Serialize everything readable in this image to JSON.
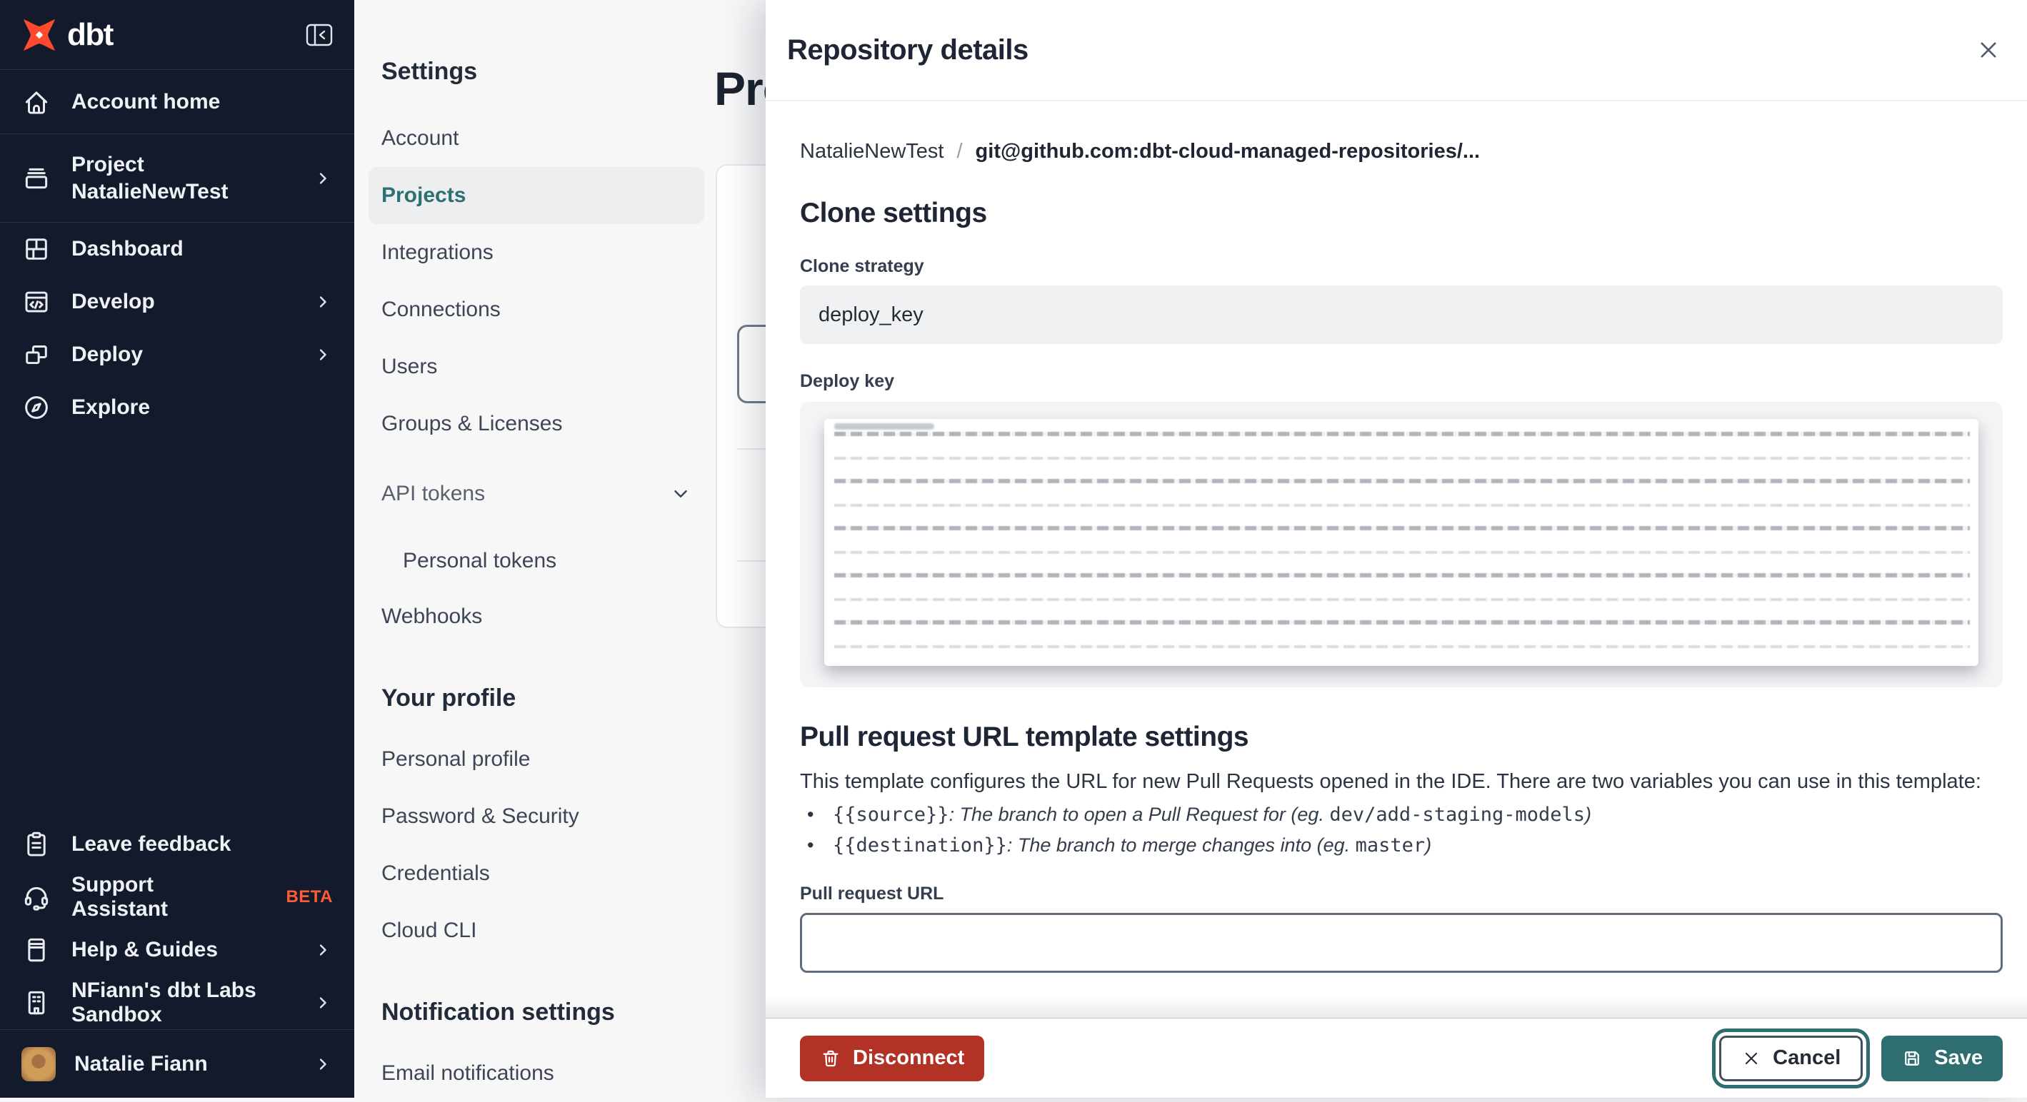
{
  "colors": {
    "brand_orange": "#ff4a2e",
    "accent_teal": "#2f6e70",
    "danger_red": "#b23226",
    "sidebar_bg": "#131a2b",
    "beta_orange": "#ff5c35"
  },
  "sidebar": {
    "logo_text": "dbt",
    "nav": [
      {
        "label": "Account home",
        "icon": "home"
      },
      {
        "label": "Project",
        "label2": "NatalieNewTest",
        "icon": "project"
      },
      {
        "label": "Dashboard",
        "icon": "dashboard"
      },
      {
        "label": "Develop",
        "icon": "develop"
      },
      {
        "label": "Deploy",
        "icon": "deploy"
      },
      {
        "label": "Explore",
        "icon": "explore"
      }
    ],
    "footer": [
      {
        "label": "Leave feedback",
        "icon": "clipboard"
      },
      {
        "label": "Support Assistant",
        "badge": "BETA",
        "icon": "headset"
      },
      {
        "label": "Help & Guides",
        "icon": "book"
      },
      {
        "label": "NFiann's dbt Labs Sandbox",
        "icon": "building"
      }
    ],
    "user": {
      "name": "Natalie Fiann"
    }
  },
  "settings_nav": {
    "title": "Settings",
    "items": {
      "account": "Account",
      "projects": "Projects",
      "integrations": "Integrations",
      "connections": "Connections",
      "users": "Users",
      "groups": "Groups & Licenses",
      "api_tokens": "API tokens",
      "personal_tokens": "Personal tokens",
      "webhooks": "Webhooks"
    },
    "profile_section": {
      "title": "Your profile",
      "personal_profile": "Personal profile",
      "password_security": "Password & Security",
      "credentials": "Credentials",
      "cloud_cli": "Cloud CLI"
    },
    "notification_section": {
      "title": "Notification settings",
      "email_notifications": "Email notifications"
    }
  },
  "main": {
    "heading": "Projects"
  },
  "drawer": {
    "title": "Repository details",
    "breadcrumb": {
      "project": "NatalieNewTest",
      "separator": "/",
      "repo": "git@github.com:dbt-cloud-managed-repositories/..."
    },
    "clone": {
      "heading": "Clone settings",
      "strategy_label": "Clone strategy",
      "strategy_value": "deploy_key",
      "deploy_key_label": "Deploy key"
    },
    "pr_template": {
      "heading": "Pull request URL template settings",
      "description": "This template configures the URL for new Pull Requests opened in the IDE. There are two variables you can use in this template:",
      "bullet_glyph": "•",
      "bullets": [
        {
          "code": "{{source}}",
          "desc": ": The branch to open a Pull Request for (eg. ",
          "example": "dev/add-staging-models",
          "close": ")"
        },
        {
          "code": "{{destination}}",
          "desc": ": The branch to merge changes into (eg. ",
          "example": "master",
          "close": ")"
        }
      ]
    },
    "pr_url": {
      "label": "Pull request URL",
      "value": ""
    },
    "footer": {
      "disconnect": "Disconnect",
      "cancel": "Cancel",
      "save": "Save"
    }
  }
}
